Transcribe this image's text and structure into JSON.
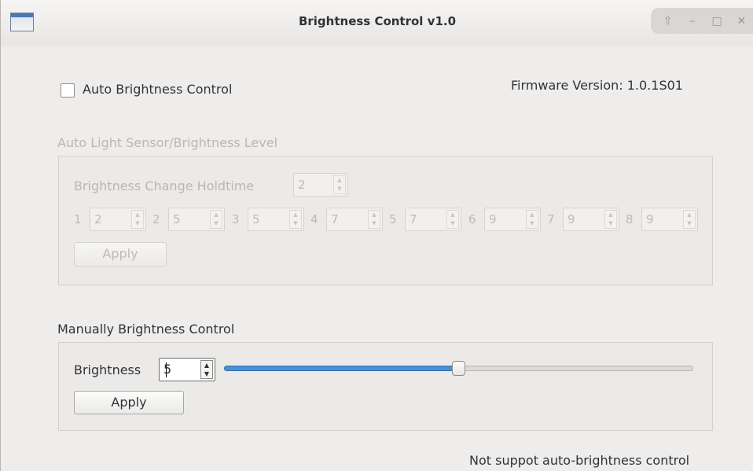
{
  "window": {
    "title": "Brightness Control v1.0",
    "buttons": [
      "up-icon",
      "minimize-icon",
      "maximize-icon",
      "close-icon"
    ],
    "glyphs": {
      "up": "⇧",
      "minimize": "–",
      "maximize": "□",
      "close": "✕"
    }
  },
  "auto": {
    "checkbox_label": "Auto Brightness Control",
    "checked": false,
    "firmware": "Firmware Version: 1.0.1S01"
  },
  "sensor": {
    "group_label": "Auto Light Sensor/Brightness Level",
    "holdtime_label": "Brightness Change Holdtime",
    "holdtime_value": "2",
    "levels": [
      {
        "index": "1",
        "value": "2"
      },
      {
        "index": "2",
        "value": "5"
      },
      {
        "index": "3",
        "value": "5"
      },
      {
        "index": "4",
        "value": "7"
      },
      {
        "index": "5",
        "value": "7"
      },
      {
        "index": "6",
        "value": "9"
      },
      {
        "index": "7",
        "value": "9"
      },
      {
        "index": "8",
        "value": "9"
      }
    ],
    "apply_label": "Apply"
  },
  "manual": {
    "group_label": "Manually Brightness Control",
    "brightness_label": "Brightness",
    "brightness_value": "5",
    "slider_fraction": 0.5,
    "apply_label": "Apply"
  },
  "status": {
    "text": "Not suppot auto-brightness control"
  },
  "colors": {
    "accent": "#4a90d9",
    "window_bg": "#eeedec",
    "disabled_text": "#b9b7b3"
  }
}
